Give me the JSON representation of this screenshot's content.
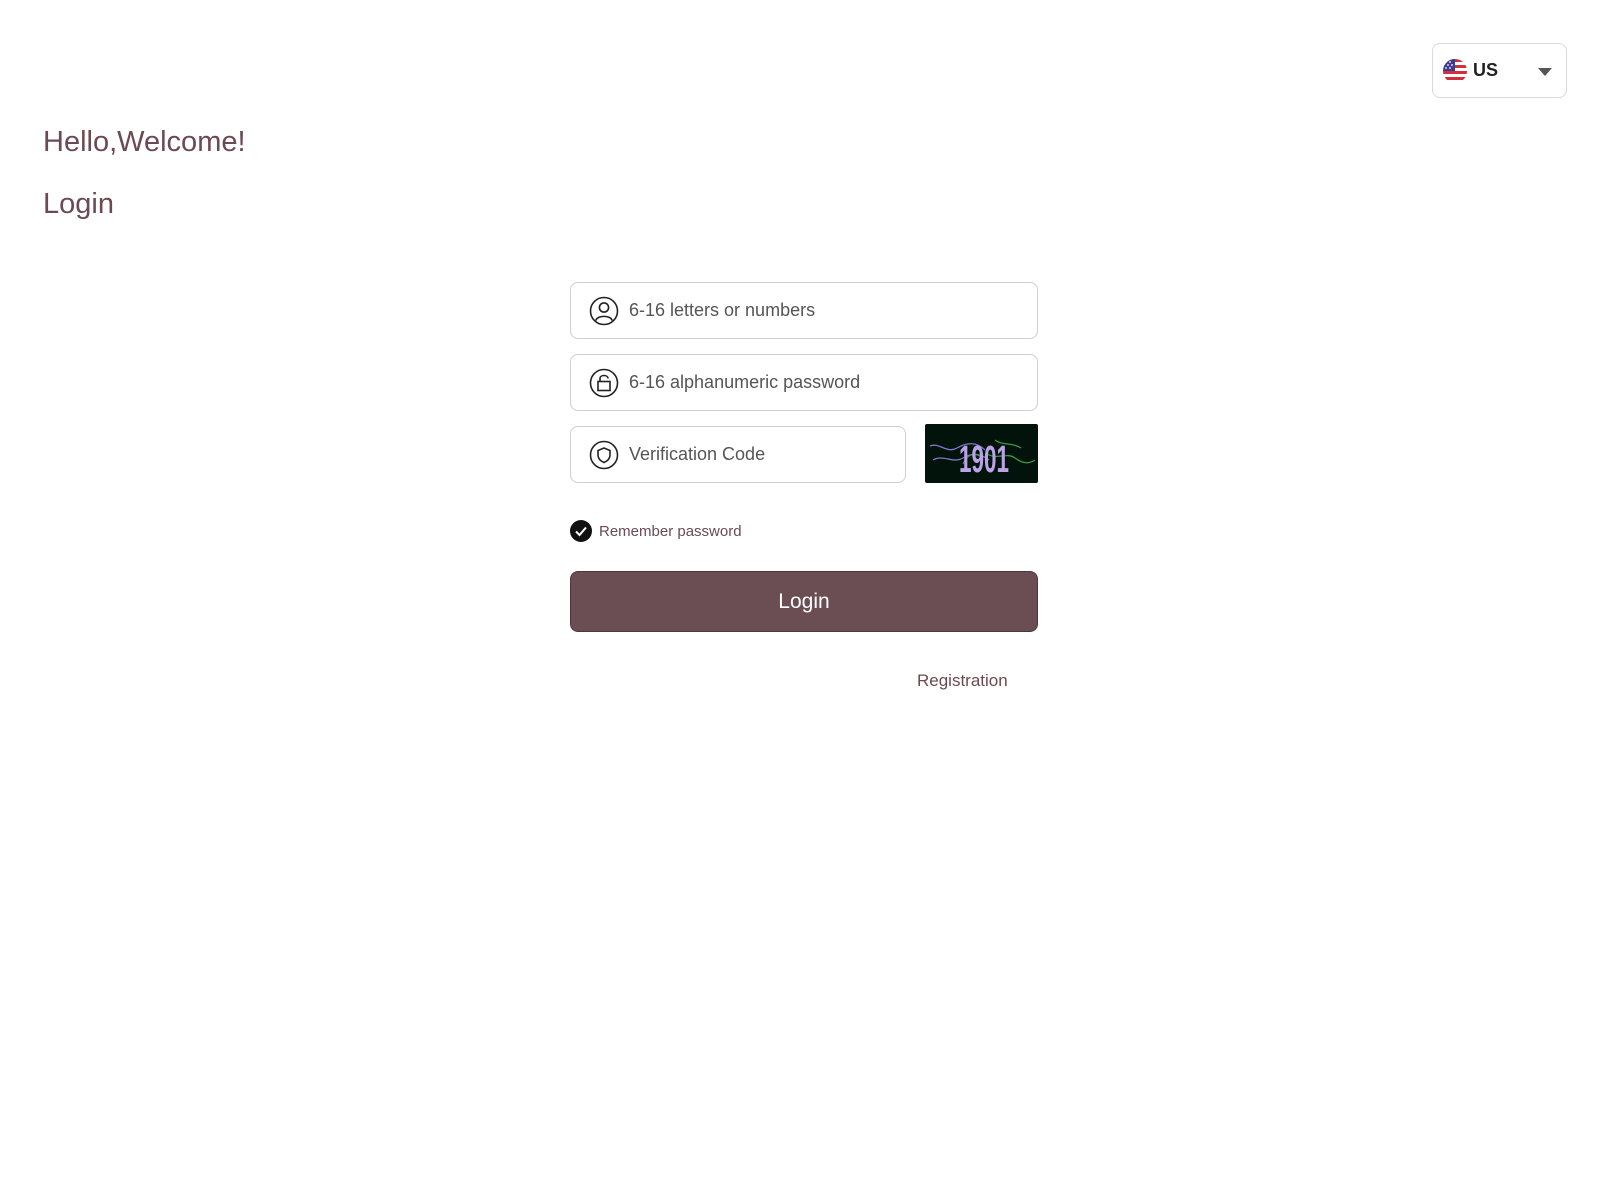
{
  "language": {
    "selected": "US",
    "icon": "us-flag-icon"
  },
  "header": {
    "welcome": "Hello,Welcome!",
    "title": "Login"
  },
  "form": {
    "username": {
      "placeholder": "6-16 letters or numbers",
      "value": "",
      "icon": "user-icon"
    },
    "password": {
      "placeholder": "6-16 alphanumeric password",
      "value": "",
      "icon": "lock-icon"
    },
    "code": {
      "placeholder": "Verification Code",
      "value": "",
      "icon": "shield-icon"
    },
    "captcha_text": "1901",
    "remember_label": "Remember password",
    "remember_checked": true,
    "login_label": "Login",
    "registration_label": "Registration"
  },
  "colors": {
    "primary": "#6b4e53",
    "text": "#6b4a51",
    "captcha_bg": "#02130c",
    "captcha_text": "#b9a3e6"
  }
}
